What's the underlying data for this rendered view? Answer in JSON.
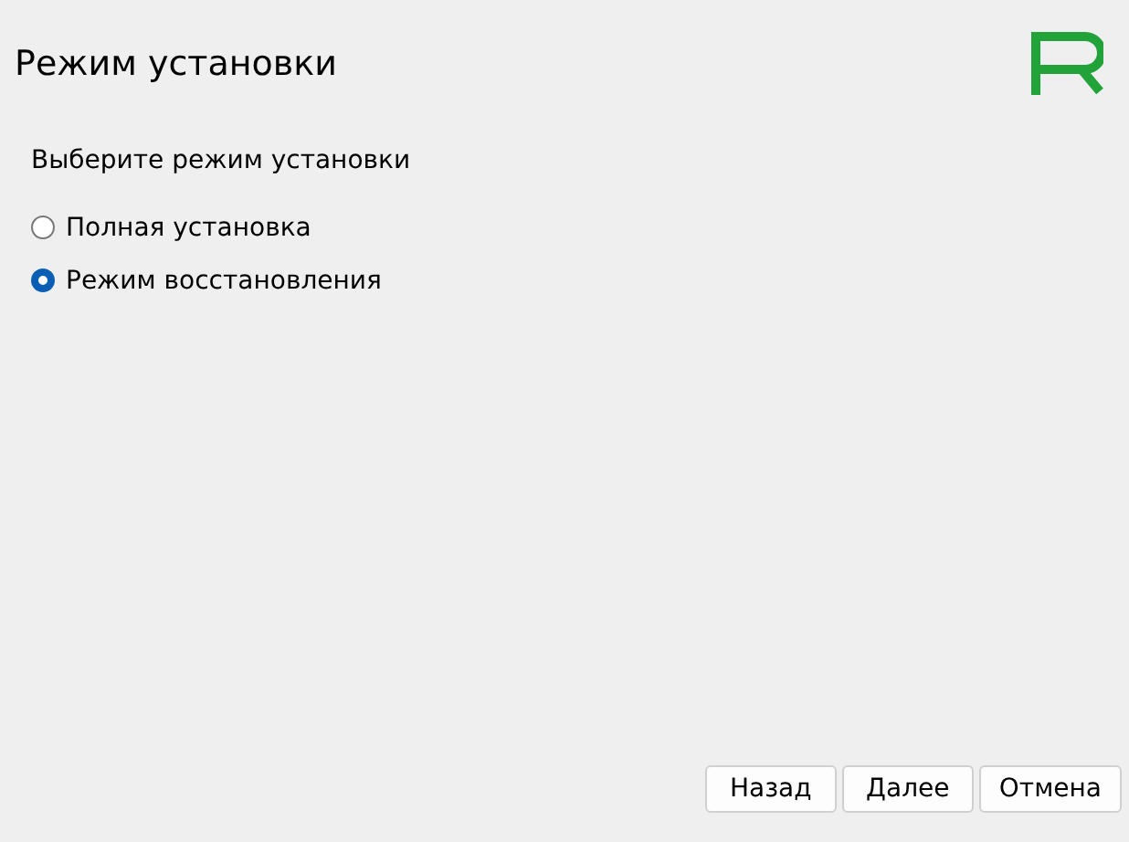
{
  "header": {
    "title": "Режим установки"
  },
  "prompt": "Выберите режим установки",
  "options": [
    {
      "label": "Полная установка",
      "selected": false
    },
    {
      "label": "Режим восстановления",
      "selected": true
    }
  ],
  "buttons": [
    "Назад",
    "Далее",
    "Отмена"
  ]
}
